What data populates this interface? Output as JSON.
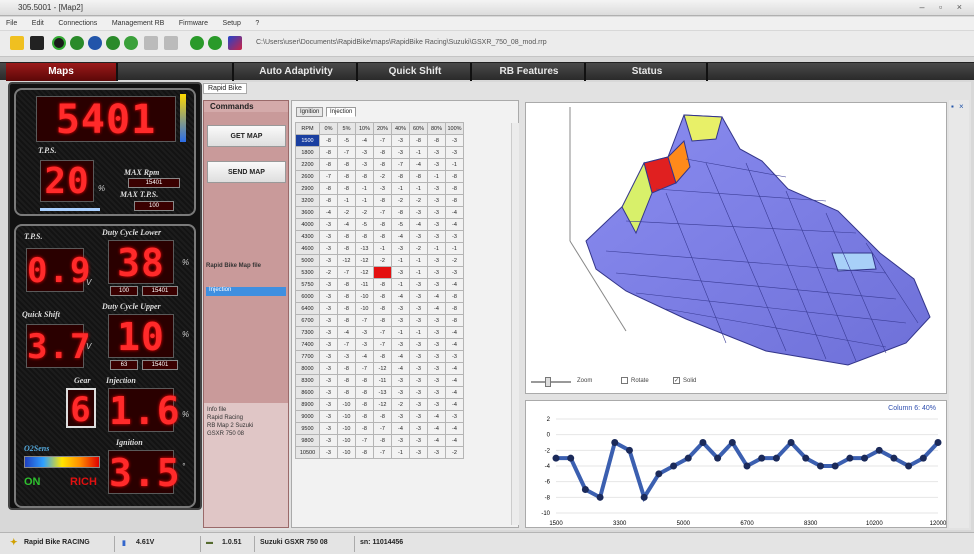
{
  "window": {
    "title": "305.5001 - [Map2]",
    "controls": "– ▫ ×"
  },
  "menu": [
    "File",
    "Edit",
    "Connections",
    "Management RB",
    "Firmware",
    "Setup",
    "?"
  ],
  "toolbar": {
    "file_path": "C:\\Users\\user\\Documents\\RapidBike\\maps\\RapidBike Racing\\Suzuki\\GSXR_750_08_mod.rrp"
  },
  "tabs": [
    "Maps",
    "",
    "Auto Adaptivity",
    "Quick Shift",
    "RB Features",
    "Status"
  ],
  "dashboard": {
    "rpm": "5401",
    "tps_label": "T.P.S.",
    "tps_value": "20",
    "tps_unit": "%",
    "max_rpm_label": "MAX Rpm",
    "max_rpm_value": "15401",
    "max_tps_label": "MAX T.P.S.",
    "max_tps_value": "100",
    "tps_v_label": "T.P.S.",
    "tps_v_value": "0.9",
    "tps_v_unit": "V",
    "duty_lower_label": "Duty Cycle Lower",
    "duty_lower_value": "38",
    "duty_lower_min": "100",
    "duty_lower_max": "15401",
    "duty_unit": "%",
    "quick_shift_label": "Quick Shift",
    "quick_shift_value": "3.7",
    "quick_shift_unit": "V",
    "duty_upper_label": "Duty Cycle Upper",
    "duty_upper_value": "10",
    "duty_upper_min": "63",
    "duty_upper_max": "15401",
    "gear_label": "Gear",
    "gear_value": "6",
    "injection_label": "Injection",
    "injection_value": "1.6",
    "ignition_label": "Ignition",
    "ignition_value": "3.5",
    "ignition_unit": "°",
    "o2_label": "O2Sens",
    "on_label": "ON",
    "rich_label": "RICH"
  },
  "content": {
    "rapid_tab": "Rapid Bike",
    "commands_header": "Commands",
    "get_map": "GET MAP",
    "send_map": "SEND MAP",
    "map_file_label": "Rapid Bike Map file",
    "map_file_selected": "Injection",
    "info": [
      "Info file",
      "Rapid Racing",
      "RB Map 2 Suzuki",
      "GSXR 750 08"
    ],
    "subtab_ignition": "Ignition",
    "subtab_injection": "Injection",
    "table_headers": [
      "RPM",
      "0%",
      "5%",
      "10%",
      "20%",
      "40%",
      "60%",
      "80%",
      "100%"
    ],
    "table_rows": [
      [
        "1500",
        "-8",
        "-5",
        "-4",
        "-7",
        "-3",
        "-8",
        "-8",
        "-3"
      ],
      [
        "1800",
        "-8",
        "-7",
        "-3",
        "-8",
        "-3",
        "-1",
        "-3",
        "-3"
      ],
      [
        "2200",
        "-8",
        "-8",
        "-3",
        "-8",
        "-7",
        "-4",
        "-3",
        "-1"
      ],
      [
        "2600",
        "-7",
        "-8",
        "-8",
        "-2",
        "-8",
        "-8",
        "-1",
        "-8"
      ],
      [
        "2900",
        "-8",
        "-8",
        "-1",
        "-3",
        "-1",
        "-1",
        "-3",
        "-8"
      ],
      [
        "3200",
        "-8",
        "-1",
        "-1",
        "-8",
        "-2",
        "-2",
        "-3",
        "-8"
      ],
      [
        "3600",
        "-4",
        "-2",
        "-2",
        "-7",
        "-8",
        "-3",
        "-3",
        "-4"
      ],
      [
        "4000",
        "-3",
        "-4",
        "-5",
        "-8",
        "-5",
        "-4",
        "-3",
        "-4"
      ],
      [
        "4300",
        "-3",
        "-8",
        "-8",
        "-8",
        "-4",
        "-3",
        "-3",
        "-3"
      ],
      [
        "4600",
        "-3",
        "-8",
        "-13",
        "-1",
        "-3",
        "-2",
        "-1",
        "-1"
      ],
      [
        "5000",
        "-3",
        "-12",
        "-12",
        "-2",
        "-1",
        "-1",
        "-3",
        "-2"
      ],
      [
        "5300",
        "-2",
        "-7",
        "-12",
        "",
        "-3",
        "-1",
        "-3",
        "-3"
      ],
      [
        "5750",
        "-3",
        "-8",
        "-11",
        "-8",
        "-1",
        "-3",
        "-3",
        "-4"
      ],
      [
        "6000",
        "-3",
        "-8",
        "-10",
        "-8",
        "-4",
        "-3",
        "-4",
        "-8"
      ],
      [
        "6400",
        "-3",
        "-8",
        "-10",
        "-8",
        "-3",
        "-3",
        "-4",
        "-8"
      ],
      [
        "6700",
        "-3",
        "-8",
        "-7",
        "-8",
        "-3",
        "-3",
        "-3",
        "-8"
      ],
      [
        "7300",
        "-3",
        "-4",
        "-3",
        "-7",
        "-1",
        "-1",
        "-3",
        "-4"
      ],
      [
        "7400",
        "-3",
        "-7",
        "-3",
        "-7",
        "-3",
        "-3",
        "-3",
        "-4"
      ],
      [
        "7700",
        "-3",
        "-3",
        "-4",
        "-8",
        "-4",
        "-3",
        "-3",
        "-3"
      ],
      [
        "8000",
        "-3",
        "-8",
        "-7",
        "-12",
        "-4",
        "-3",
        "-3",
        "-4"
      ],
      [
        "8300",
        "-3",
        "-8",
        "-8",
        "-11",
        "-3",
        "-3",
        "-3",
        "-4"
      ],
      [
        "8600",
        "-3",
        "-8",
        "-8",
        "-13",
        "-3",
        "-3",
        "-3",
        "-4"
      ],
      [
        "8900",
        "-3",
        "-10",
        "-8",
        "-12",
        "-2",
        "-3",
        "-3",
        "-4"
      ],
      [
        "9000",
        "-3",
        "-10",
        "-8",
        "-8",
        "-3",
        "-3",
        "-4",
        "-3"
      ],
      [
        "9500",
        "-3",
        "-10",
        "-8",
        "-7",
        "-4",
        "-3",
        "-4",
        "-4"
      ],
      [
        "9800",
        "-3",
        "-10",
        "-7",
        "-8",
        "-3",
        "-3",
        "-4",
        "-4"
      ],
      [
        "10500",
        "-3",
        "-10",
        "-8",
        "-7",
        "-1",
        "-3",
        "-3",
        "-2"
      ]
    ],
    "zoom_label": "Zoom",
    "rotate_label": "Rotate",
    "solid_label": "Solid",
    "chart2d_title": "Column 6: 40%",
    "chart2d_xticks": [
      "1500",
      "3300",
      "5000",
      "6700",
      "8300",
      "10200",
      "12000"
    ],
    "chart2d_yticks": [
      "2",
      "0",
      "-2",
      "-4",
      "-6",
      "-8",
      "-10"
    ]
  },
  "status": {
    "app": "Rapid Bike RACING",
    "voltage": "4.61V",
    "version": "1.0.51",
    "bike": "Suzuki GSXR 750 08",
    "serial": "sn: 11014456"
  }
}
